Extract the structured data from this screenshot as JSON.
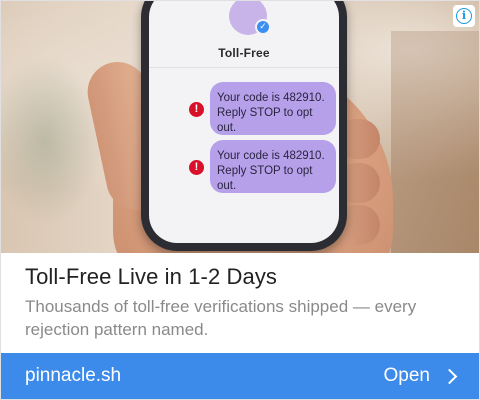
{
  "hero": {
    "phone": {
      "contact_name": "Toll-Free",
      "messages": [
        {
          "text_line1": "Your code is 482910.",
          "text_line2": "Reply STOP to opt out.",
          "status_icon": "error-icon"
        },
        {
          "text_line1": "Your code is 482910.",
          "text_line2": "Reply STOP to opt out.",
          "status_icon": "error-icon"
        }
      ],
      "verified_badge": "✓",
      "error_glyph": "!"
    },
    "info_glyph": "i"
  },
  "headline": "Toll-Free Live in 1-2 Days",
  "description": "Thousands of toll-free verifications shipped — every rejection pattern named.",
  "cta": {
    "domain": "pinnacle.sh",
    "open_label": "Open"
  },
  "colors": {
    "cta_background": "#3c8bea",
    "bubble": "#b6a0ea",
    "error": "#d8102a",
    "info": "#1a9be0"
  }
}
